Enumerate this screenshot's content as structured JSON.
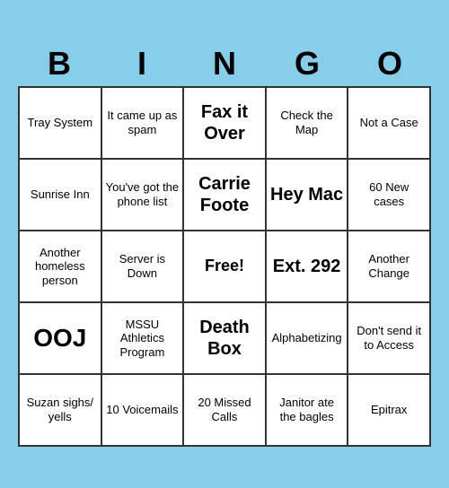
{
  "header": {
    "letters": [
      "B",
      "I",
      "N",
      "G",
      "O"
    ]
  },
  "cells": [
    {
      "text": "Tray System",
      "style": "normal"
    },
    {
      "text": "It came up as spam",
      "style": "normal"
    },
    {
      "text": "Fax it Over",
      "style": "large-text"
    },
    {
      "text": "Check the Map",
      "style": "normal"
    },
    {
      "text": "Not a Case",
      "style": "normal"
    },
    {
      "text": "Sunrise Inn",
      "style": "normal"
    },
    {
      "text": "You've got the phone list",
      "style": "normal"
    },
    {
      "text": "Carrie Foote",
      "style": "large-text"
    },
    {
      "text": "Hey Mac",
      "style": "large-text"
    },
    {
      "text": "60 New cases",
      "style": "normal"
    },
    {
      "text": "Another homeless person",
      "style": "normal"
    },
    {
      "text": "Server is Down",
      "style": "normal"
    },
    {
      "text": "Free!",
      "style": "free"
    },
    {
      "text": "Ext. 292",
      "style": "large-text"
    },
    {
      "text": "Another Change",
      "style": "normal"
    },
    {
      "text": "OOJ",
      "style": "ooj"
    },
    {
      "text": "MSSU Athletics Program",
      "style": "normal"
    },
    {
      "text": "Death Box",
      "style": "large-text"
    },
    {
      "text": "Alphabetizing",
      "style": "normal"
    },
    {
      "text": "Don't send it to Access",
      "style": "normal"
    },
    {
      "text": "Suzan sighs/ yells",
      "style": "normal"
    },
    {
      "text": "10 Voicemails",
      "style": "normal"
    },
    {
      "text": "20 Missed Calls",
      "style": "normal"
    },
    {
      "text": "Janitor ate the bagles",
      "style": "normal"
    },
    {
      "text": "Epitrax",
      "style": "normal"
    }
  ]
}
